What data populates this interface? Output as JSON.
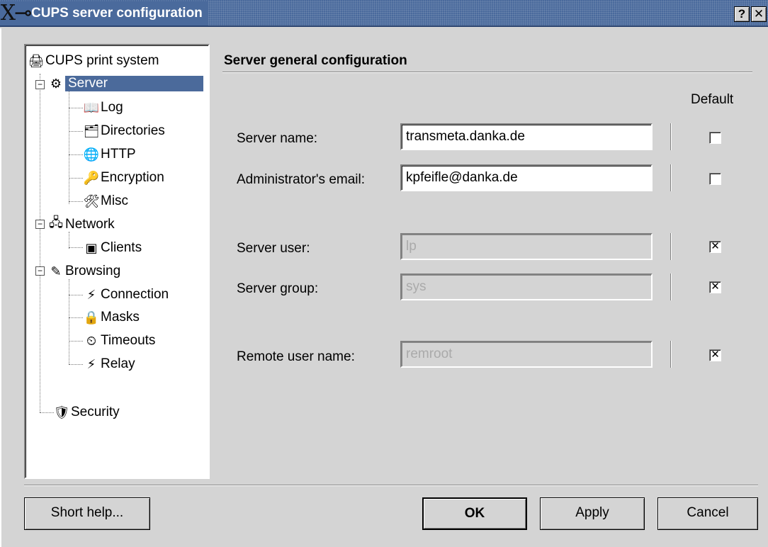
{
  "window": {
    "title": "CUPS server configuration",
    "help_button": "?",
    "close_button": "✕"
  },
  "tree": {
    "root": "CUPS print system",
    "items": [
      {
        "label": "Server",
        "icon": "server-icon",
        "selected": true
      },
      {
        "label": "Log",
        "icon": "log-icon"
      },
      {
        "label": "Directories",
        "icon": "directories-icon"
      },
      {
        "label": "HTTP",
        "icon": "http-icon"
      },
      {
        "label": "Encryption",
        "icon": "encryption-icon"
      },
      {
        "label": "Misc",
        "icon": "misc-icon"
      },
      {
        "label": "Network",
        "icon": "network-icon"
      },
      {
        "label": "Clients",
        "icon": "clients-icon"
      },
      {
        "label": "Browsing",
        "icon": "browsing-icon"
      },
      {
        "label": "Connection",
        "icon": "connection-icon"
      },
      {
        "label": "Masks",
        "icon": "masks-icon"
      },
      {
        "label": "Timeouts",
        "icon": "timeouts-icon"
      },
      {
        "label": "Relay",
        "icon": "relay-icon"
      },
      {
        "label": "Security",
        "icon": "security-icon"
      }
    ]
  },
  "panel": {
    "title": "Server general configuration",
    "default_header": "Default",
    "rows": [
      {
        "label": "Server name:",
        "value": "transmeta.danka.de",
        "enabled": true,
        "default_checked": false
      },
      {
        "label": "Administrator's email:",
        "value": "kpfeifle@danka.de",
        "enabled": true,
        "default_checked": false
      },
      {
        "label": "Server user:",
        "value": "lp",
        "enabled": false,
        "default_checked": true
      },
      {
        "label": "Server group:",
        "value": "sys",
        "enabled": false,
        "default_checked": true
      },
      {
        "label": "Remote user name:",
        "value": "remroot",
        "enabled": false,
        "default_checked": true
      }
    ]
  },
  "buttons": {
    "short_help": "Short help...",
    "ok": "OK",
    "apply": "Apply",
    "cancel": "Cancel"
  },
  "colors": {
    "titlebar": "#4a6a9c",
    "selection": "#4b6a9b",
    "window_bg": "#d4d4d4"
  }
}
